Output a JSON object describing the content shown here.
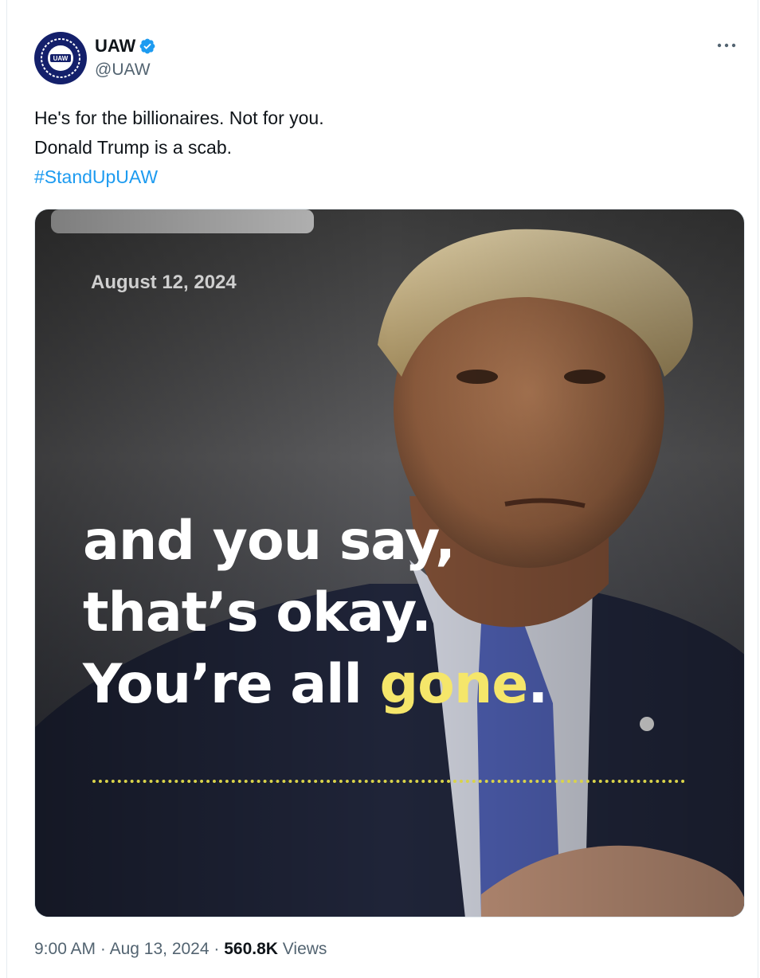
{
  "author": {
    "name": "UAW",
    "handle": "@UAW",
    "avatar_text": "UAW",
    "verified_icon": "verified-badge-icon",
    "verified_color": "#1d9bf0"
  },
  "post": {
    "lines": [
      "He's for the billionaires. Not for you.",
      "Donald Trump is a scab."
    ],
    "hashtag": "#StandUpUAW"
  },
  "media": {
    "date": "August 12, 2024",
    "caption_line1": "and you say,",
    "caption_line2": "that’s okay.",
    "caption_line3_prefix": "You’re all ",
    "caption_highlight": "gone",
    "caption_suffix": ".",
    "highlight_color": "#f5e66a"
  },
  "meta": {
    "time": "9:00 AM",
    "separator": "·",
    "date": "Aug 13, 2024",
    "views_count": "560.8K",
    "views_label": "Views"
  }
}
